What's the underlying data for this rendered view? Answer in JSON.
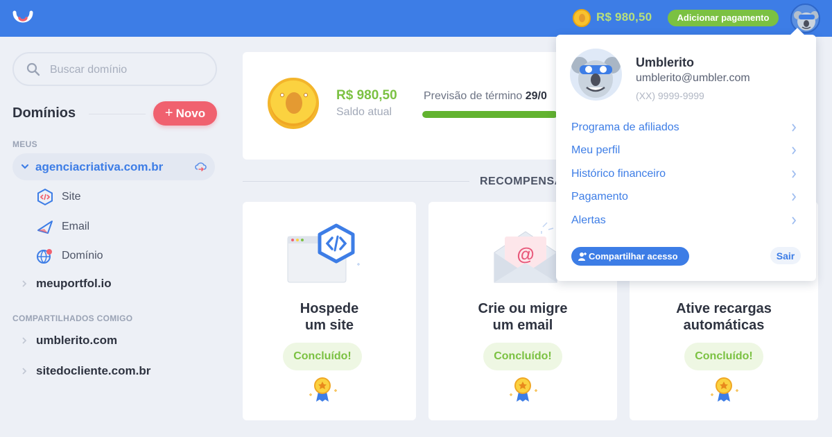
{
  "topbar": {
    "balance": "R$ 980,50",
    "add_payment_label": "Adicionar pagamento"
  },
  "sidebar": {
    "search_placeholder": "Buscar domínio",
    "title": "Domínios",
    "new_button_plus": "+",
    "new_button_label": "Novo",
    "mine_label": "MEUS",
    "active_domain": "agenciacriativa.com.br",
    "sub_items": [
      {
        "label": "Site",
        "icon": "code-hexagon-icon"
      },
      {
        "label": "Email",
        "icon": "paper-plane-icon"
      },
      {
        "label": "Domínio",
        "icon": "globe-pin-icon"
      }
    ],
    "other_domain": "meuportfol.io",
    "shared_label": "COMPARTILHADOS COMIGO",
    "shared_domains": [
      "umblerito.com",
      "sitedocliente.com.br"
    ]
  },
  "balance_card": {
    "amount": "R$ 980,50",
    "label": "Saldo atual",
    "forecast_prefix": "Previsão de término",
    "forecast_date": "29/0",
    "progress": 0.97
  },
  "rewards": {
    "title": "RECOMPENSA",
    "cards": [
      {
        "title_line1": "Hospede",
        "title_line2": "um site",
        "status": "Concluído!",
        "icon": "code-window-icon"
      },
      {
        "title_line1": "Crie ou migre",
        "title_line2": "um email",
        "status": "Concluído!",
        "icon": "email-envelope-icon"
      },
      {
        "title_line1": "Ative recargas",
        "title_line2": "automáticas",
        "status": "Concluído!",
        "icon": "recharge-icon"
      }
    ]
  },
  "dropdown": {
    "name": "Umblerito",
    "email": "umblerito@umbler.com",
    "phone": "(XX) 9999-9999",
    "menu": [
      "Programa de afiliados",
      "Meu perfil",
      "Histórico financeiro",
      "Pagamento",
      "Alertas"
    ],
    "share_label": "Compartilhar acesso",
    "logout_label": "Sair"
  },
  "colors": {
    "brand_blue": "#3d7de6",
    "green": "#7bc142",
    "coral": "#f0616f"
  }
}
